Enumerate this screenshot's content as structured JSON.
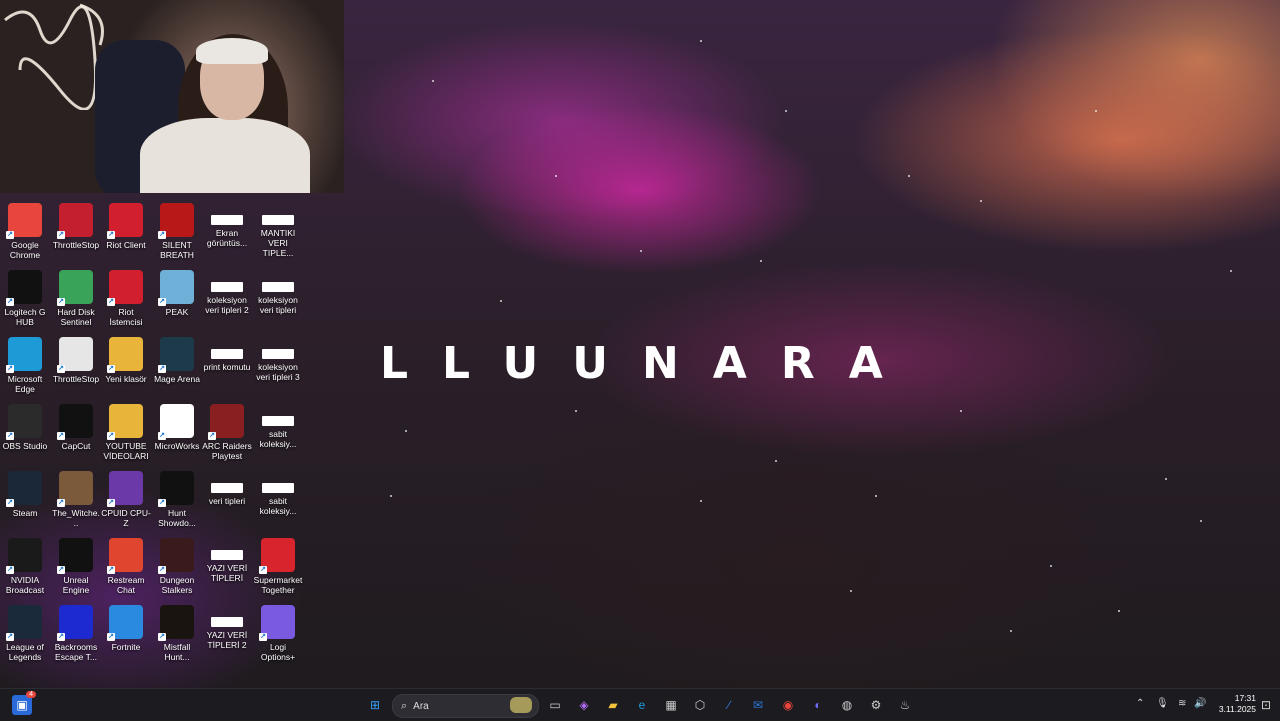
{
  "brand_text": "LLUUNARA",
  "desktop_icons": [
    {
      "label": "Google Chrome",
      "icon": "chrome-icon",
      "color": "#e8453c"
    },
    {
      "label": "ThrottleStop",
      "icon": "throttlestop-icon",
      "color": "#c41f2e"
    },
    {
      "label": "Riot Client",
      "icon": "riot-icon",
      "color": "#d21f2e"
    },
    {
      "label": "SILENT BREATH",
      "icon": "silent-breath-icon",
      "color": "#b81818"
    },
    {
      "label": "Ekran görüntüs...",
      "icon": "document-icon",
      "color": "#ffffff"
    },
    {
      "label": "MANTIKI VERI TIPLE...",
      "icon": "document-icon",
      "color": "#ffffff"
    },
    {
      "label": "Logitech G HUB",
      "icon": "logitech-icon",
      "color": "#111111"
    },
    {
      "label": "Hard Disk Sentinel",
      "icon": "hdd-sentinel-icon",
      "color": "#3aa35a"
    },
    {
      "label": "Riot İstemcisi",
      "icon": "riot-icon",
      "color": "#d21f2e"
    },
    {
      "label": "PEAK",
      "icon": "peak-icon",
      "color": "#6fb0d8"
    },
    {
      "label": "koleksiyon veri tipleri 2",
      "icon": "document-icon",
      "color": "#ffffff"
    },
    {
      "label": "koleksiyon veri tipleri",
      "icon": "document-icon",
      "color": "#ffffff"
    },
    {
      "label": "Microsoft Edge",
      "icon": "edge-icon",
      "color": "#1e9bd7"
    },
    {
      "label": "ThrottleStop",
      "icon": "gear-file-icon",
      "color": "#e6e6e6"
    },
    {
      "label": "Yeni klasör",
      "icon": "folder-icon",
      "color": "#e8b53a"
    },
    {
      "label": "Mage Arena",
      "icon": "mage-arena-icon",
      "color": "#1d3a4a"
    },
    {
      "label": "print komutu",
      "icon": "document-icon",
      "color": "#ffffff"
    },
    {
      "label": "koleksiyon veri tipleri 3",
      "icon": "document-icon",
      "color": "#ffffff"
    },
    {
      "label": "OBS Studio",
      "icon": "obs-icon",
      "color": "#2b2b2b"
    },
    {
      "label": "CapCut",
      "icon": "capcut-icon",
      "color": "#111111"
    },
    {
      "label": "YOUTUBE VİDEOLARI",
      "icon": "folder-icon",
      "color": "#e8b53a"
    },
    {
      "label": "MicroWorks",
      "icon": "microworks-icon",
      "color": "#ffffff"
    },
    {
      "label": "ARC Raiders Playtest",
      "icon": "arc-raiders-icon",
      "color": "#8a1f22"
    },
    {
      "label": "sabit koleksiy...",
      "icon": "document-icon",
      "color": "#ffffff"
    },
    {
      "label": "Steam",
      "icon": "steam-icon",
      "color": "#1b2838"
    },
    {
      "label": "The_Witche...",
      "icon": "witcher-icon",
      "color": "#7a5a3a"
    },
    {
      "label": "CPUID CPU-Z",
      "icon": "cpuz-icon",
      "color": "#6b3aa8"
    },
    {
      "label": "Hunt Showdo...",
      "icon": "hunt-icon",
      "color": "#111111"
    },
    {
      "label": "veri tipleri",
      "icon": "document-icon",
      "color": "#ffffff"
    },
    {
      "label": "sabit koleksiy...",
      "icon": "document-icon",
      "color": "#ffffff"
    },
    {
      "label": "NVIDIA Broadcast",
      "icon": "nvidia-icon",
      "color": "#1a1a1a"
    },
    {
      "label": "Unreal Engine",
      "icon": "unreal-icon",
      "color": "#111111"
    },
    {
      "label": "Restream Chat",
      "icon": "restream-icon",
      "color": "#e0452f"
    },
    {
      "label": "Dungeon Stalkers",
      "icon": "dungeon-stalkers-icon",
      "color": "#3a1a1a"
    },
    {
      "label": "YAZI VERİ TİPLERİ",
      "icon": "document-icon",
      "color": "#ffffff"
    },
    {
      "label": "Supermarket Together",
      "icon": "supermarket-icon",
      "color": "#d8242c"
    },
    {
      "label": "League of Legends",
      "icon": "league-icon",
      "color": "#1a2a3a"
    },
    {
      "label": "Backrooms Escape T...",
      "icon": "backrooms-icon",
      "color": "#1c2ad0"
    },
    {
      "label": "Fortnite",
      "icon": "fortnite-icon",
      "color": "#2a8ae0"
    },
    {
      "label": "Mistfall Hunt...",
      "icon": "mistfall-icon",
      "color": "#1a1410"
    },
    {
      "label": "YAZI VERİ TİPLERİ 2",
      "icon": "document-icon",
      "color": "#ffffff"
    },
    {
      "label": "Logi Options+",
      "icon": "logi-options-icon",
      "color": "#7a5ae0"
    }
  ],
  "taskbar": {
    "search_placeholder": "Ara",
    "notification_count": "4",
    "time": "17:31",
    "date": "3.11.2025",
    "pinned": [
      {
        "icon": "windows-start-icon",
        "glyph": "⊞",
        "color": "#3aa0ff"
      },
      {
        "icon": "task-view-icon",
        "glyph": "▭",
        "color": "#cfcfcf"
      },
      {
        "icon": "copilot-icon",
        "glyph": "◈",
        "color": "#b06af0"
      },
      {
        "icon": "file-explorer-icon",
        "glyph": "▰",
        "color": "#f2c23a"
      },
      {
        "icon": "edge-icon",
        "glyph": "e",
        "color": "#1e9bd7"
      },
      {
        "icon": "store-icon",
        "glyph": "▦",
        "color": "#cfcfcf"
      },
      {
        "icon": "app-icon",
        "glyph": "⬡",
        "color": "#cfcfcf"
      },
      {
        "icon": "vs-code-icon",
        "glyph": "∕",
        "color": "#3a7ae0"
      },
      {
        "icon": "outlook-icon",
        "glyph": "✉",
        "color": "#2a7ad8"
      },
      {
        "icon": "chrome-icon",
        "glyph": "◉",
        "color": "#e8453c"
      },
      {
        "icon": "discord-icon",
        "glyph": "◐",
        "color": "#6a6ef2"
      },
      {
        "icon": "obs-icon",
        "glyph": "◍",
        "color": "#cfcfcf"
      },
      {
        "icon": "settings-icon",
        "glyph": "⚙",
        "color": "#cfcfcf"
      },
      {
        "icon": "steam-icon",
        "glyph": "♨",
        "color": "#cfcfcf"
      }
    ],
    "tray": [
      {
        "icon": "chevron-up-icon",
        "glyph": "⌃"
      },
      {
        "icon": "microphone-icon",
        "glyph": "🎙"
      },
      {
        "icon": "wifi-icon",
        "glyph": "≋"
      },
      {
        "icon": "volume-icon",
        "glyph": "🔊"
      }
    ]
  }
}
